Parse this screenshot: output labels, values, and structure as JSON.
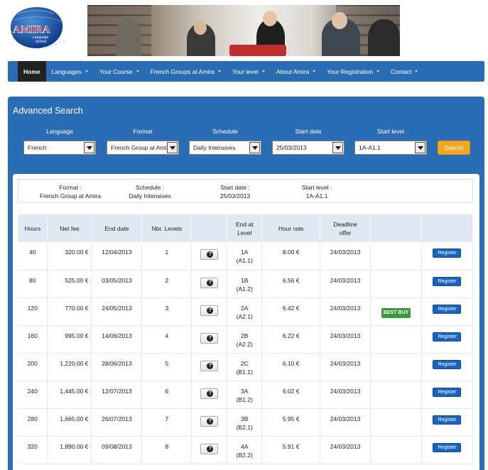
{
  "header": {
    "logo": {
      "name": "AMIRA",
      "sub1": "Language",
      "sub2": "School",
      "tagline": "The Power of Speech"
    }
  },
  "nav": {
    "items": [
      {
        "label": "Home",
        "active": true,
        "caret": false
      },
      {
        "label": "Languages",
        "caret": true
      },
      {
        "label": "Your Course",
        "caret": true
      },
      {
        "label": "French Groups at Amira",
        "caret": true
      },
      {
        "label": "Your level",
        "caret": true
      },
      {
        "label": "About Amira",
        "caret": true
      },
      {
        "label": "Your Registration",
        "caret": true
      },
      {
        "label": "Contact",
        "caret": true
      }
    ]
  },
  "search": {
    "title": "Advanced Search",
    "filters": [
      {
        "label": "Language",
        "value": "French"
      },
      {
        "label": "Format",
        "value": "French Group at Amira"
      },
      {
        "label": "Schedule",
        "value": "Daily Intensives"
      },
      {
        "label": "Start date",
        "value": "25/03/2013"
      },
      {
        "label": "Start level",
        "value": "1A-A1.1"
      }
    ],
    "button": "Search"
  },
  "summary": {
    "format_label": "Format :",
    "format_value": "French Group at Amira",
    "schedule_label": "Schedule :",
    "schedule_value": "Daily Intensives",
    "start_date_label": "Start date :",
    "start_date_value": "25/03/2013",
    "start_level_label": "Start level :",
    "start_level_value": "1A-A1.1"
  },
  "table": {
    "headers": [
      "Hours",
      "Net fee",
      "End date",
      "Nbr. Levels",
      "",
      "End at Level",
      "Hour rate",
      "Deadline offer",
      "",
      ""
    ],
    "register_label": "Register",
    "best_buy_label": "BEST BUY",
    "rows": [
      {
        "hours": "40",
        "fee": "320.00 €",
        "end": "12/04/2013",
        "levels": "1",
        "level": "1A",
        "cefr": "(A1.1)",
        "rate": "8.00 €",
        "deadline": "24/03/2013",
        "badge": ""
      },
      {
        "hours": "80",
        "fee": "525.00 €",
        "end": "03/05/2013",
        "levels": "2",
        "level": "1B",
        "cefr": "(A1.2)",
        "rate": "6.56 €",
        "deadline": "24/03/2013",
        "badge": ""
      },
      {
        "hours": "120",
        "fee": "770.00 €",
        "end": "24/05/2013",
        "levels": "3",
        "level": "2A",
        "cefr": "(A2.1)",
        "rate": "6.42 €",
        "deadline": "24/03/2013",
        "badge": "BEST BUY"
      },
      {
        "hours": "160",
        "fee": "995.00 €",
        "end": "14/06/2013",
        "levels": "4",
        "level": "2B",
        "cefr": "(A2.2)",
        "rate": "6.22 €",
        "deadline": "24/03/2013",
        "badge": ""
      },
      {
        "hours": "200",
        "fee": "1,220.00 €",
        "end": "28/06/2013",
        "levels": "5",
        "level": "2C",
        "cefr": "(B1.1)",
        "rate": "6.10 €",
        "deadline": "24/03/2013",
        "badge": ""
      },
      {
        "hours": "240",
        "fee": "1,445.00 €",
        "end": "12/07/2013",
        "levels": "6",
        "level": "3A",
        "cefr": "(B1.2)",
        "rate": "6.02 €",
        "deadline": "24/03/2013",
        "badge": ""
      },
      {
        "hours": "280",
        "fee": "1,665.00 €",
        "end": "26/07/2013",
        "levels": "7",
        "level": "3B",
        "cefr": "(B2.1)",
        "rate": "5.95 €",
        "deadline": "24/03/2013",
        "badge": ""
      },
      {
        "hours": "320",
        "fee": "1,890.00 €",
        "end": "09/08/2013",
        "levels": "8",
        "level": "4A",
        "cefr": "(B2.2)",
        "rate": "5.91 €",
        "deadline": "24/03/2013",
        "badge": ""
      }
    ]
  },
  "colors": {
    "primary": "#2a6db5",
    "search": "#f5a623",
    "best_buy": "#3c9a3c",
    "register": "#1a64c0"
  }
}
